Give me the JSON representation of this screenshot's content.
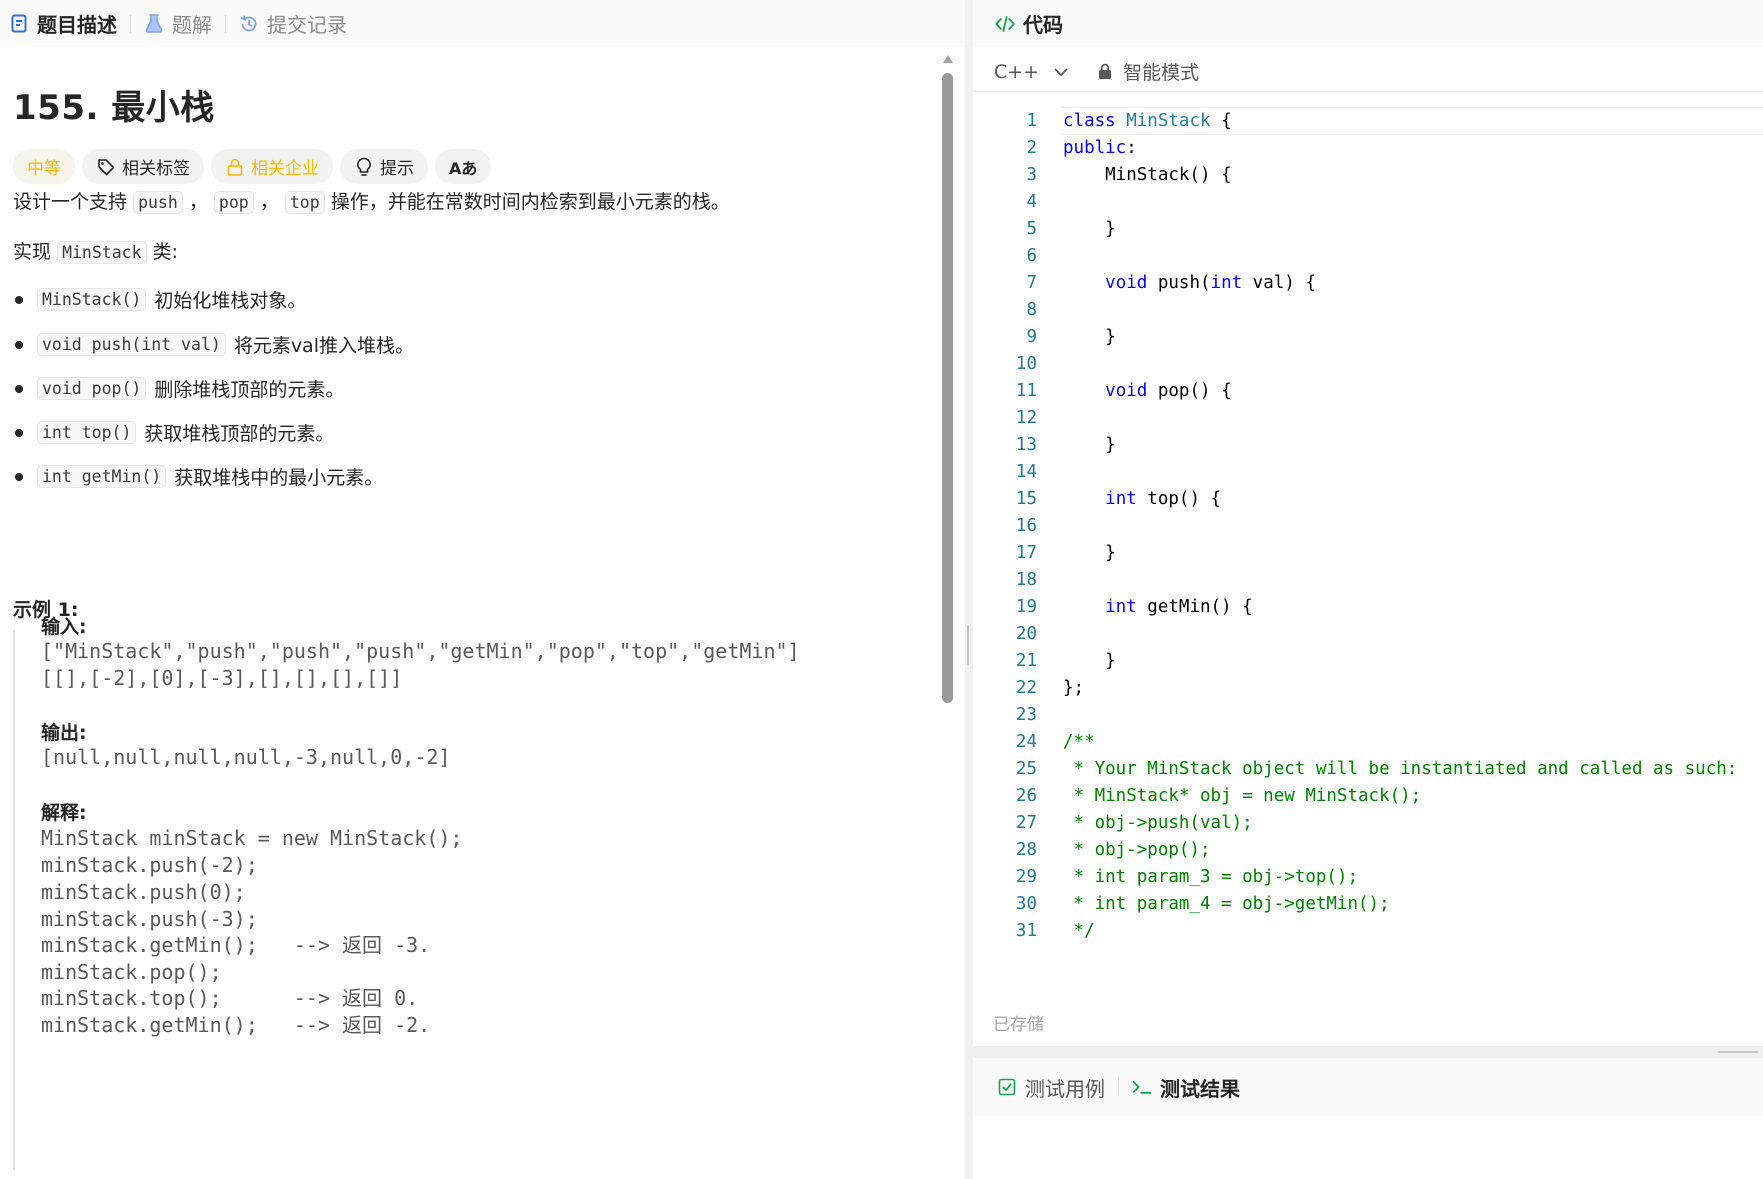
{
  "left_tabs": [
    {
      "label": "题目描述",
      "active": true
    },
    {
      "label": "题解",
      "active": false
    },
    {
      "label": "提交记录",
      "active": false
    }
  ],
  "problem": {
    "title": "155. 最小栈",
    "tags": {
      "difficulty": "中等",
      "related_tags": "相关标签",
      "related_companies": "相关企业",
      "hint": "提示",
      "font": "Aあ"
    },
    "desc": {
      "p1_pre": "设计一个支持",
      "p1_code1": "push",
      "p1_sep1": "，",
      "p1_code2": "pop",
      "p1_sep2": "，",
      "p1_code3": "top",
      "p1_post": "操作，并能在常数时间内检索到最小元素的栈。",
      "p2_pre": "实现",
      "p2_code": "MinStack",
      "p2_post": "类:"
    },
    "bullets": [
      {
        "code": "MinStack()",
        "text": "初始化堆栈对象。"
      },
      {
        "code": "void push(int val)",
        "text": "将元素val推入堆栈。"
      },
      {
        "code": "void pop()",
        "text": "删除堆栈顶部的元素。"
      },
      {
        "code": "int top()",
        "text": "获取堆栈顶部的元素。"
      },
      {
        "code": "int getMin()",
        "text": "获取堆栈中的最小元素。"
      }
    ],
    "example": {
      "title": "示例 1:",
      "input_label": "输入:",
      "input_line1": "[\"MinStack\",\"push\",\"push\",\"push\",\"getMin\",\"pop\",\"top\",\"getMin\"]",
      "input_line2": "[[],[-2],[0],[-3],[],[],[],[]]",
      "output_label": "输出:",
      "output_line": "[null,null,null,null,-3,null,0,-2]",
      "explain_label": "解释:",
      "explain_lines": [
        "MinStack minStack = new MinStack();",
        "minStack.push(-2);",
        "minStack.push(0);",
        "minStack.push(-3);",
        "minStack.getMin();   --> 返回 -3.",
        "minStack.pop();",
        "minStack.top();      --> 返回 0.",
        "minStack.getMin();   --> 返回 -2."
      ]
    }
  },
  "code_panel": {
    "title": "代码",
    "language": "C++",
    "mode": "智能模式",
    "saved_status": "已存储"
  },
  "code_lines": [
    {
      "n": "1",
      "html": "<span class=\"kw\">class</span> <span class=\"ty\">MinStack</span> {"
    },
    {
      "n": "2",
      "html": "<span class=\"kw\">public</span>:"
    },
    {
      "n": "3",
      "html": "    MinStack() {"
    },
    {
      "n": "4",
      "html": ""
    },
    {
      "n": "5",
      "html": "    }"
    },
    {
      "n": "6",
      "html": ""
    },
    {
      "n": "7",
      "html": "    <span class=\"kw\">void</span> push(<span class=\"kw\">int</span> val) {"
    },
    {
      "n": "8",
      "html": ""
    },
    {
      "n": "9",
      "html": "    }"
    },
    {
      "n": "10",
      "html": ""
    },
    {
      "n": "11",
      "html": "    <span class=\"kw\">void</span> pop() {"
    },
    {
      "n": "12",
      "html": ""
    },
    {
      "n": "13",
      "html": "    }"
    },
    {
      "n": "14",
      "html": ""
    },
    {
      "n": "15",
      "html": "    <span class=\"kw\">int</span> top() {"
    },
    {
      "n": "16",
      "html": ""
    },
    {
      "n": "17",
      "html": "    }"
    },
    {
      "n": "18",
      "html": ""
    },
    {
      "n": "19",
      "html": "    <span class=\"kw\">int</span> getMin() {"
    },
    {
      "n": "20",
      "html": ""
    },
    {
      "n": "21",
      "html": "    }"
    },
    {
      "n": "22",
      "html": "};"
    },
    {
      "n": "23",
      "html": ""
    },
    {
      "n": "24",
      "html": "<span class=\"cm\">/**</span>"
    },
    {
      "n": "25",
      "html": "<span class=\"cm\"> * Your MinStack object will be instantiated and called as such:</span>"
    },
    {
      "n": "26",
      "html": "<span class=\"cm\"> * MinStack* obj = new MinStack();</span>"
    },
    {
      "n": "27",
      "html": "<span class=\"cm\"> * obj-&gt;push(val);</span>"
    },
    {
      "n": "28",
      "html": "<span class=\"cm\"> * obj-&gt;pop();</span>"
    },
    {
      "n": "29",
      "html": "<span class=\"cm\"> * int param_3 = obj-&gt;top();</span>"
    },
    {
      "n": "30",
      "html": "<span class=\"cm\"> * int param_4 = obj-&gt;getMin();</span>"
    },
    {
      "n": "31",
      "html": "<span class=\"cm\"> */</span>"
    }
  ],
  "bottom_tabs": [
    {
      "label": "测试用例",
      "active": false
    },
    {
      "label": "测试结果",
      "active": true
    }
  ],
  "colors": {
    "difficulty_medium": "#ffb800",
    "keyword": "#0000ff",
    "type": "#267f99",
    "comment": "#008000",
    "line_number": "#237893"
  }
}
